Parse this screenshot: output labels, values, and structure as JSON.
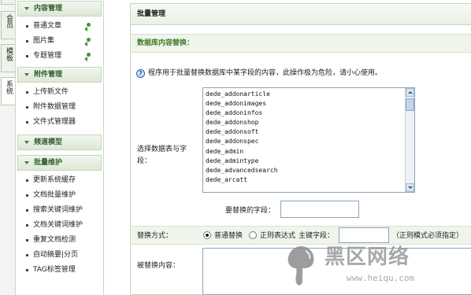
{
  "vertical_tabs": [
    {
      "label": "会员"
    },
    {
      "label": "模板"
    },
    {
      "label": "系统"
    }
  ],
  "sidebar": {
    "groups": [
      {
        "title": "内容管理",
        "items": [
          {
            "label": "普通文章",
            "has_add": true
          },
          {
            "label": "图片集",
            "has_add": true
          },
          {
            "label": "专题管理",
            "has_add": true
          }
        ]
      },
      {
        "title": "附件管理",
        "items": [
          {
            "label": "上传新文件"
          },
          {
            "label": "附件数据管理"
          },
          {
            "label": "文件式管理器"
          }
        ]
      },
      {
        "title": "频道模型",
        "items": []
      },
      {
        "title": "批量维护",
        "items": [
          {
            "label": "更新系统缓存"
          },
          {
            "label": "文档批量维护"
          },
          {
            "label": "搜索关键词维护"
          },
          {
            "label": "文档关键词维护"
          },
          {
            "label": "重复文档检测"
          },
          {
            "label": "自动摘要|分页"
          },
          {
            "label": "TAG标签管理"
          }
        ]
      }
    ]
  },
  "main": {
    "title": "批量管理",
    "section_title": "数据库内容替换：",
    "info_text": "程序用于批量替换数据库中某字段的内容，此操作极为危险，请小心使用。",
    "table_select_label": "选择数据表与字段：",
    "tables": [
      "dede_addonarticle",
      "dede_addonimages",
      "dede_addoninfos",
      "dede_addonshop",
      "dede_addonsoft",
      "dede_addonspec",
      "dede_admin",
      "dede_admintype",
      "dede_advancedsearch",
      "dede_arcatt"
    ],
    "field_label": "要替换的字段：",
    "field_value": "",
    "mode_label": "替换方式：",
    "mode_options": [
      {
        "label": "普通替换",
        "selected": true
      },
      {
        "label": "正则表达式",
        "selected": false
      }
    ],
    "key_label": "主键字段：",
    "key_value": "",
    "key_note": "（正则模式必须指定）",
    "replace_label": "被替换内容："
  },
  "watermark": {
    "brand": "黑区网络",
    "url": "www.heiqu.com"
  },
  "colors": {
    "accent_green": "#3f7a2b",
    "header_bg": "#f0f5ec",
    "border": "#c6d6bd"
  }
}
